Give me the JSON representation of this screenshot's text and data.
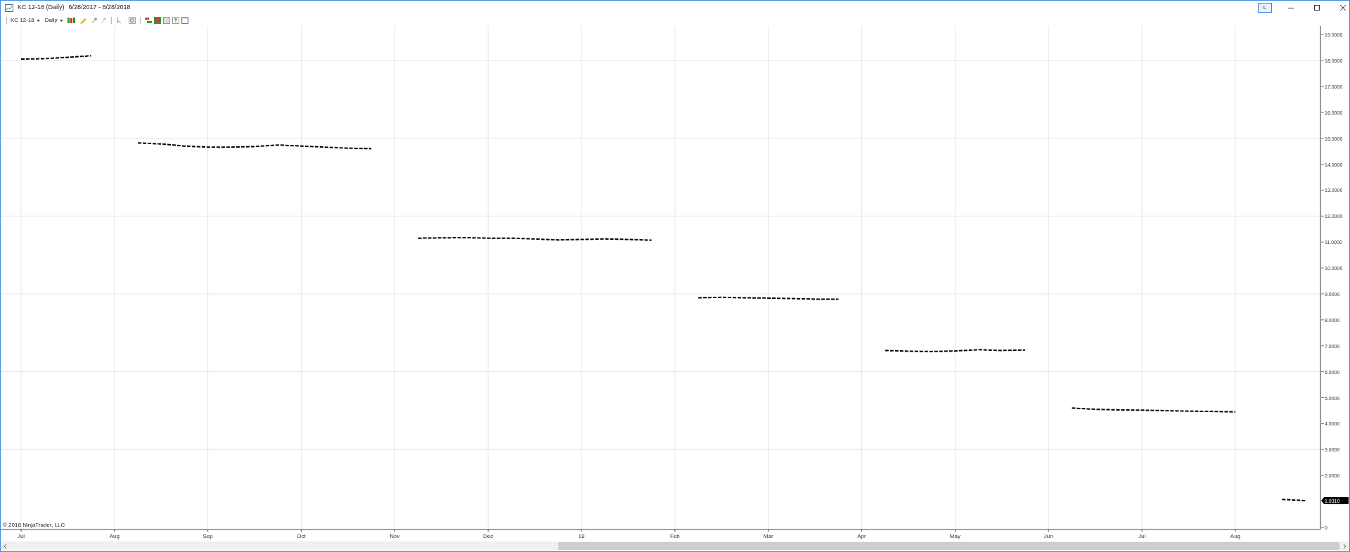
{
  "window": {
    "title": "KC 12-18 (Daily)",
    "date_range": "6/28/2017 - 8/28/2018",
    "title_button": "L"
  },
  "toolbar": {
    "instrument": "KC 12-18",
    "interval": "Daily"
  },
  "chart": {
    "copyright": "© 2018 NinjaTrader, LLC",
    "price_marker": "1.0310",
    "chart_data": {
      "type": "line",
      "grid": true,
      "ylim": [
        0,
        19.3
      ],
      "yticks": [
        {
          "value": 0,
          "label": "0"
        },
        {
          "value": 2,
          "label": "2.0000"
        },
        {
          "value": 3,
          "label": "3.0000"
        },
        {
          "value": 4,
          "label": "4.0000"
        },
        {
          "value": 5,
          "label": "5.0000"
        },
        {
          "value": 6,
          "label": "6.0000"
        },
        {
          "value": 7,
          "label": "7.0000"
        },
        {
          "value": 8,
          "label": "8.0000"
        },
        {
          "value": 9,
          "label": "9.0000"
        },
        {
          "value": 10,
          "label": "10.0000"
        },
        {
          "value": 11,
          "label": "11.0000"
        },
        {
          "value": 12,
          "label": "12.0000"
        },
        {
          "value": 13,
          "label": "13.0000"
        },
        {
          "value": 14,
          "label": "14.0000"
        },
        {
          "value": 15,
          "label": "15.0000"
        },
        {
          "value": 16,
          "label": "16.0000"
        },
        {
          "value": 17,
          "label": "17.0000"
        },
        {
          "value": 18,
          "label": "18.0000"
        },
        {
          "value": 19,
          "label": "19.0000"
        }
      ],
      "categories": [
        "Jul",
        null,
        null,
        null,
        "Aug",
        null,
        null,
        null,
        "Sep",
        null,
        null,
        null,
        "Oct",
        null,
        null,
        null,
        "Nov",
        null,
        null,
        null,
        "Dec",
        null,
        null,
        null,
        "18",
        null,
        null,
        null,
        "Feb",
        null,
        null,
        null,
        "Mar",
        null,
        null,
        null,
        "Apr",
        null,
        null,
        null,
        "May",
        null,
        null,
        null,
        "Jun",
        null,
        null,
        null,
        "Jul",
        null,
        null,
        null,
        "Aug",
        null,
        null,
        null
      ],
      "series": [
        {
          "color": "#000000",
          "line_style": "dashed",
          "values": [
            18.05,
            18.07,
            18.12,
            18.18,
            null,
            14.82,
            14.78,
            14.7,
            14.66,
            14.66,
            14.68,
            14.74,
            14.7,
            14.66,
            14.62,
            14.6,
            null,
            11.15,
            11.16,
            11.17,
            11.15,
            11.15,
            11.12,
            11.08,
            11.1,
            11.12,
            11.1,
            11.07,
            null,
            8.85,
            8.87,
            8.85,
            8.84,
            8.82,
            8.8,
            8.8,
            null,
            6.82,
            6.79,
            6.78,
            6.8,
            6.85,
            6.82,
            6.84,
            null,
            4.6,
            4.55,
            4.53,
            4.52,
            4.5,
            4.48,
            4.47,
            4.45,
            null,
            1.08,
            1.03
          ]
        }
      ]
    }
  }
}
